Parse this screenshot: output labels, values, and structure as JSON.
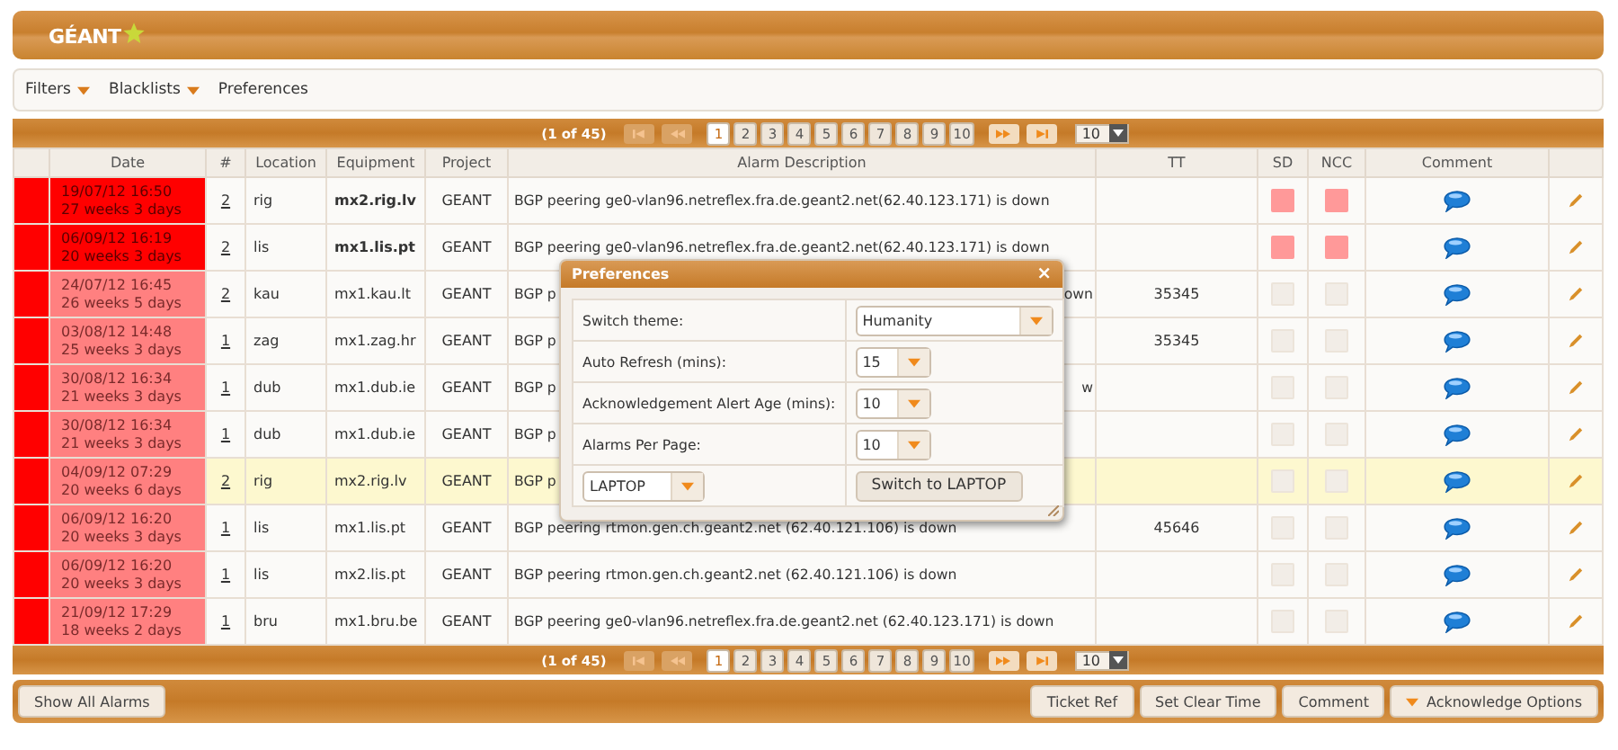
{
  "logo": {
    "text": "GÉANT"
  },
  "menu": [
    {
      "label": "Filters",
      "dropdown": true
    },
    {
      "label": "Blacklists",
      "dropdown": true
    },
    {
      "label": "Preferences",
      "dropdown": false
    }
  ],
  "pagers": [
    {
      "info": "(1 of 45)",
      "pages": [
        {
          "label": "1",
          "selected": true
        },
        {
          "label": "2",
          "selected": false
        },
        {
          "label": "3",
          "selected": false
        },
        {
          "label": "4",
          "selected": false
        },
        {
          "label": "5",
          "selected": false
        },
        {
          "label": "6",
          "selected": false
        },
        {
          "label": "7",
          "selected": false
        },
        {
          "label": "8",
          "selected": false
        },
        {
          "label": "9",
          "selected": false
        },
        {
          "label": "10",
          "selected": false
        }
      ],
      "per_page": "10"
    },
    {
      "info": "(1 of 45)",
      "pages": [
        {
          "label": "1",
          "selected": true
        },
        {
          "label": "2",
          "selected": false
        },
        {
          "label": "3",
          "selected": false
        },
        {
          "label": "4",
          "selected": false
        },
        {
          "label": "5",
          "selected": false
        },
        {
          "label": "6",
          "selected": false
        },
        {
          "label": "7",
          "selected": false
        },
        {
          "label": "8",
          "selected": false
        },
        {
          "label": "9",
          "selected": false
        },
        {
          "label": "10",
          "selected": false
        }
      ],
      "per_page": "10"
    }
  ],
  "columns": [
    "Date",
    "#",
    "Location",
    "Equipment",
    "Project",
    "Alarm Description",
    "TT",
    "SD",
    "NCC",
    "Comment"
  ],
  "rows": [
    {
      "date": "19/07/12 16:50",
      "age": "27 weeks 3 days",
      "critical": true,
      "count": "2",
      "location": "rig",
      "equipment": "mx2.rig.lv",
      "project": "GEANT",
      "description": "BGP peering ge0-vlan96.netreflex.fra.de.geant2.net(62.40.123.171) is down",
      "tt": "",
      "sd": true,
      "ncc": true,
      "bold": true,
      "selected": false
    },
    {
      "date": "06/09/12 16:19",
      "age": "20 weeks 3 days",
      "critical": true,
      "count": "2",
      "location": "lis",
      "equipment": "mx1.lis.pt",
      "project": "GEANT",
      "description": "BGP peering ge0-vlan96.netreflex.fra.de.geant2.net(62.40.123.171) is down",
      "tt": "",
      "sd": true,
      "ncc": true,
      "bold": true,
      "selected": false
    },
    {
      "date": "24/07/12 16:45",
      "age": "26 weeks 5 days",
      "critical": false,
      "count": "2",
      "location": "kau",
      "equipment": "mx1.kau.lt",
      "project": "GEANT",
      "description": "BGP p",
      "tail": "own",
      "tt": "35345",
      "sd": false,
      "ncc": false,
      "bold": false,
      "selected": false
    },
    {
      "date": "03/08/12 14:48",
      "age": "25 weeks 3 days",
      "critical": false,
      "count": "1",
      "location": "zag",
      "equipment": "mx1.zag.hr",
      "project": "GEANT",
      "description": "BGP p",
      "tt": "35345",
      "sd": false,
      "ncc": false,
      "bold": false,
      "selected": false
    },
    {
      "date": "30/08/12 16:34",
      "age": "21 weeks 3 days",
      "critical": false,
      "count": "1",
      "location": "dub",
      "equipment": "mx1.dub.ie",
      "project": "GEANT",
      "description": "BGP p",
      "tail": "w",
      "tt": "",
      "sd": false,
      "ncc": false,
      "bold": false,
      "selected": false
    },
    {
      "date": "30/08/12 16:34",
      "age": "21 weeks 3 days",
      "critical": false,
      "count": "1",
      "location": "dub",
      "equipment": "mx1.dub.ie",
      "project": "GEANT",
      "description": "BGP p",
      "tt": "",
      "sd": false,
      "ncc": false,
      "bold": false,
      "selected": false
    },
    {
      "date": "04/09/12 07:29",
      "age": "20 weeks 6 days",
      "critical": false,
      "count": "2",
      "location": "rig",
      "equipment": "mx2.rig.lv",
      "project": "GEANT",
      "description": "BGP p",
      "tt": "",
      "sd": false,
      "ncc": false,
      "bold": false,
      "selected": true
    },
    {
      "date": "06/09/12 16:20",
      "age": "20 weeks 3 days",
      "critical": false,
      "count": "1",
      "location": "lis",
      "equipment": "mx1.lis.pt",
      "project": "GEANT",
      "description": "BGP peering rtmon.gen.ch.geant2.net (62.40.121.106) is down",
      "tt": "45646",
      "sd": false,
      "ncc": false,
      "bold": false,
      "selected": false
    },
    {
      "date": "06/09/12 16:20",
      "age": "20 weeks 3 days",
      "critical": false,
      "count": "1",
      "location": "lis",
      "equipment": "mx2.lis.pt",
      "project": "GEANT",
      "description": "BGP peering rtmon.gen.ch.geant2.net (62.40.121.106) is down",
      "tt": "",
      "sd": false,
      "ncc": false,
      "bold": false,
      "selected": false
    },
    {
      "date": "21/09/12 17:29",
      "age": "18 weeks 2 days",
      "critical": false,
      "count": "1",
      "location": "bru",
      "equipment": "mx1.bru.be",
      "project": "GEANT",
      "description": "BGP peering ge0-vlan96.netreflex.fra.de.geant2.net (62.40.123.171) is down",
      "tt": "",
      "sd": false,
      "ncc": false,
      "bold": false,
      "selected": false
    }
  ],
  "dialog": {
    "title": "Preferences",
    "close": "×",
    "fields": [
      {
        "label": "Switch theme:",
        "value": "Humanity",
        "kind": "wide"
      },
      {
        "label": "Auto Refresh (mins):",
        "value": "15",
        "kind": "small"
      },
      {
        "label": "Acknowledgement Alert Age (mins):",
        "value": "10",
        "kind": "small"
      },
      {
        "label": "Alarms Per Page:",
        "value": "10",
        "kind": "small"
      }
    ],
    "device": "LAPTOP",
    "switch_button": "Switch to LAPTOP"
  },
  "left_buttons": [
    "Show All Alarms"
  ],
  "right_buttons": [
    {
      "label": "Ticket Ref",
      "dropdown": false
    },
    {
      "label": "Set Clear Time",
      "dropdown": false
    },
    {
      "label": "Comment",
      "dropdown": false
    },
    {
      "label": "Acknowledge Options",
      "dropdown": true
    }
  ]
}
